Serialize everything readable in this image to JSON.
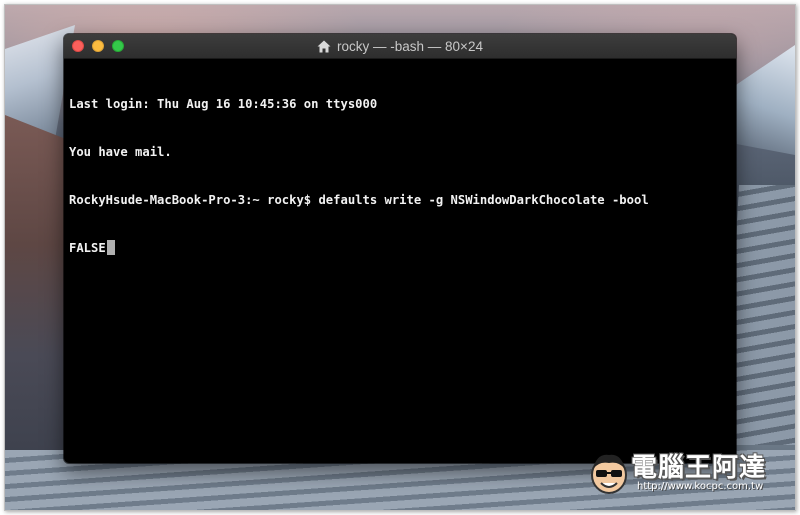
{
  "window": {
    "title": "rocky — -bash — 80×24",
    "title_icon": "home-icon"
  },
  "terminal": {
    "lines": [
      "Last login: Thu Aug 16 10:45:36 on ttys000",
      "You have mail.",
      "RockyHsude-MacBook-Pro-3:~ rocky$ defaults write -g NSWindowDarkChocolate -bool",
      "FALSE"
    ],
    "background_color": "#000000",
    "text_color": "#f2f2f2"
  },
  "traffic_lights": {
    "close_color": "#fc605c",
    "minimize_color": "#fdbc40",
    "maximize_color": "#34c84a"
  },
  "watermark": {
    "title": "電腦王阿達",
    "url": "http://www.kocpc.com.tw",
    "icon": "mascot-face-icon"
  }
}
